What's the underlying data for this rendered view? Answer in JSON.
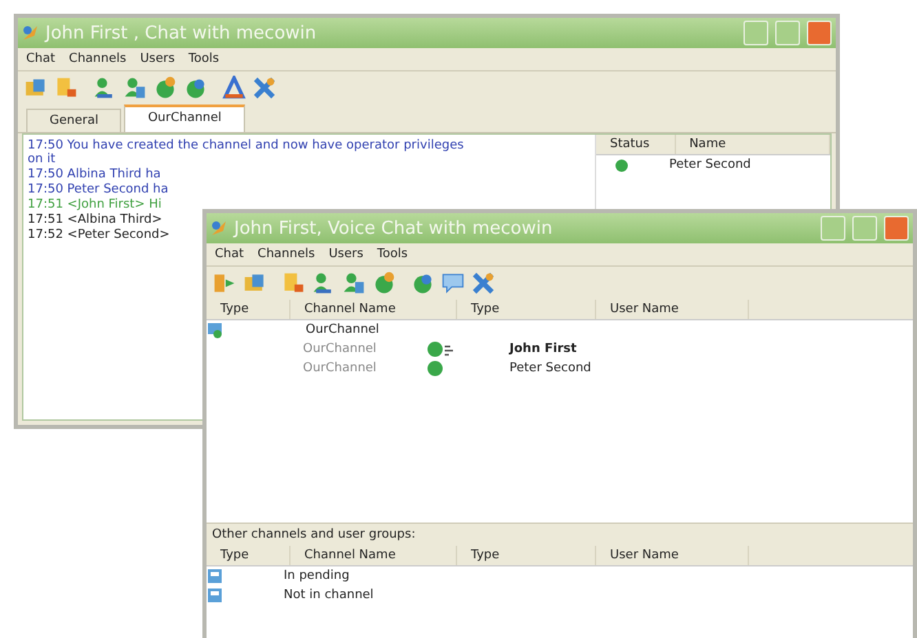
{
  "back_window": {
    "title": "John First , Chat with mecowin",
    "menu": [
      "Chat",
      "Channels",
      "Users",
      "Tools"
    ],
    "tabs": [
      {
        "label": "General",
        "selected": false
      },
      {
        "label": "OurChannel",
        "selected": true
      }
    ],
    "messages": [
      {
        "kind": "system",
        "text": "17:50 You have created the channel and now have operator privileges on it"
      },
      {
        "kind": "system",
        "text": "17:50 Albina Third ha"
      },
      {
        "kind": "system",
        "text": "17:50 Peter Second ha"
      },
      {
        "kind": "own",
        "text": "17:51 <John First> Hi"
      },
      {
        "kind": "other",
        "text": "17:51 <Albina Third> "
      },
      {
        "kind": "other",
        "text": "17:52 <Peter Second>"
      }
    ],
    "users": {
      "columns": [
        "Status",
        "Name"
      ],
      "rows": [
        {
          "name": "Peter Second",
          "online": true
        }
      ]
    }
  },
  "front_window": {
    "title": "John First, Voice Chat with mecowin",
    "menu": [
      "Chat",
      "Channels",
      "Users",
      "Tools"
    ],
    "columns": [
      "Type",
      "Channel Name",
      "Type",
      "User Name"
    ],
    "channels": [
      {
        "name": "OurChannel",
        "children": [
          {
            "channel": "OurChannel",
            "user": "John First",
            "self": true,
            "talking": true
          },
          {
            "channel": "OurChannel",
            "user": "Peter Second",
            "self": false,
            "talking": false
          }
        ]
      }
    ],
    "other_title": "Other channels and user groups:",
    "other_columns": [
      "Type",
      "Channel Name",
      "Type",
      "User Name"
    ],
    "other_rows": [
      {
        "name": "In pending"
      },
      {
        "name": "Not in channel"
      }
    ]
  }
}
